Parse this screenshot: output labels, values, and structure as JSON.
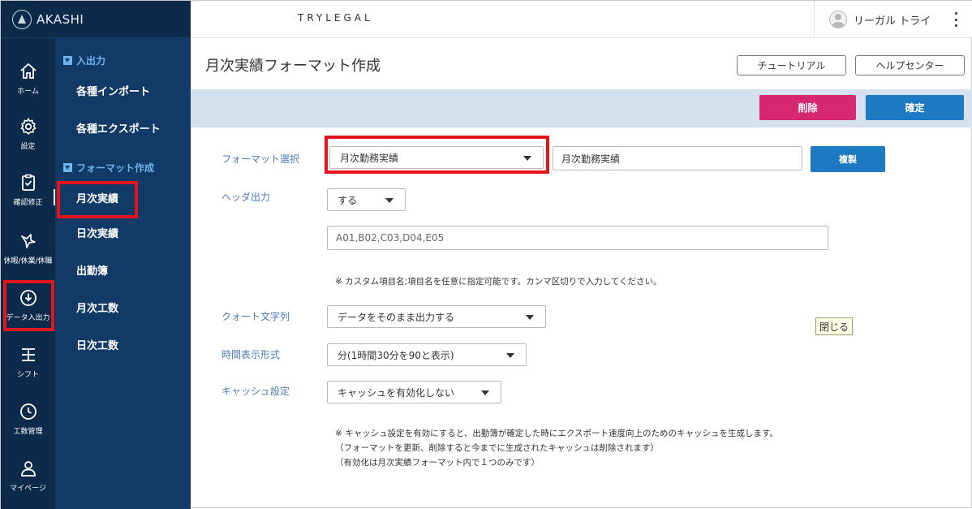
{
  "brand": {
    "logo_text": "AKASHI"
  },
  "header": {
    "company": "TRYLEGAL",
    "user_name": "リーガル トライ"
  },
  "rail": {
    "items": [
      {
        "label": "ホーム",
        "icon": "home-icon"
      },
      {
        "label": "設定",
        "icon": "gear-icon"
      },
      {
        "label": "確認修正",
        "icon": "clipboard-check-icon"
      },
      {
        "label": "休暇/休業/休職",
        "icon": "vacation-icon"
      },
      {
        "label": "データ入出力",
        "icon": "download-circle-icon"
      },
      {
        "label": "シフト",
        "icon": "shift-icon"
      },
      {
        "label": "工数管理",
        "icon": "clock-icon"
      },
      {
        "label": "マイページ",
        "icon": "person-icon"
      }
    ]
  },
  "subnav": {
    "section1": "入出力",
    "section1_items": [
      "各種インポート",
      "各種エクスポート"
    ],
    "section2": "フォーマット作成",
    "section2_items": [
      "月次実績",
      "日次実績",
      "出勤簿",
      "月次工数",
      "日次工数"
    ]
  },
  "page": {
    "title": "月次実績フォーマット作成",
    "tutorial_label": "チュートリアル",
    "help_label": "ヘルプセンター",
    "delete_label": "削除",
    "confirm_label": "確定"
  },
  "form": {
    "format_select_label": "フォーマット選択",
    "format_select_value": "月次勤務実績",
    "format_name_value": "月次勤務実績",
    "duplicate_label": "複製",
    "header_output_label": "ヘッダ出力",
    "header_output_value": "する",
    "custom_items_placeholder": "A01,B02,C03,D04,E05",
    "custom_items_note": "※ カスタム項目名;項目名を任意に指定可能です。カンマ区切りで入力してください。",
    "quote_label": "クォート文字列",
    "quote_value": "データをそのまま出力する",
    "time_format_label": "時間表示形式",
    "time_format_value": "分(1時間30分を90と表示)",
    "cache_label": "キャッシュ設定",
    "cache_value": "キャッシュを有効化しない",
    "cache_note_1": "※ キャッシュ設定を有効にすると、出勤簿が確定した時にエクスポート速度向上のためのキャッシュを生成します。",
    "cache_note_2": "（フォーマットを更新、削除すると今までに生成されたキャッシュは削除されます）",
    "cache_note_3": "（有効化は月次実績フォーマット内で１つのみです）",
    "tooltip": "閉じる"
  },
  "colors": {
    "rail_bg": "#0d2a4a",
    "subnav_bg": "#123a66",
    "accent_blue": "#1e79c3",
    "delete_pink": "#d6286f",
    "highlight_red": "#e3141c",
    "label_blue": "#4a7bb5"
  }
}
